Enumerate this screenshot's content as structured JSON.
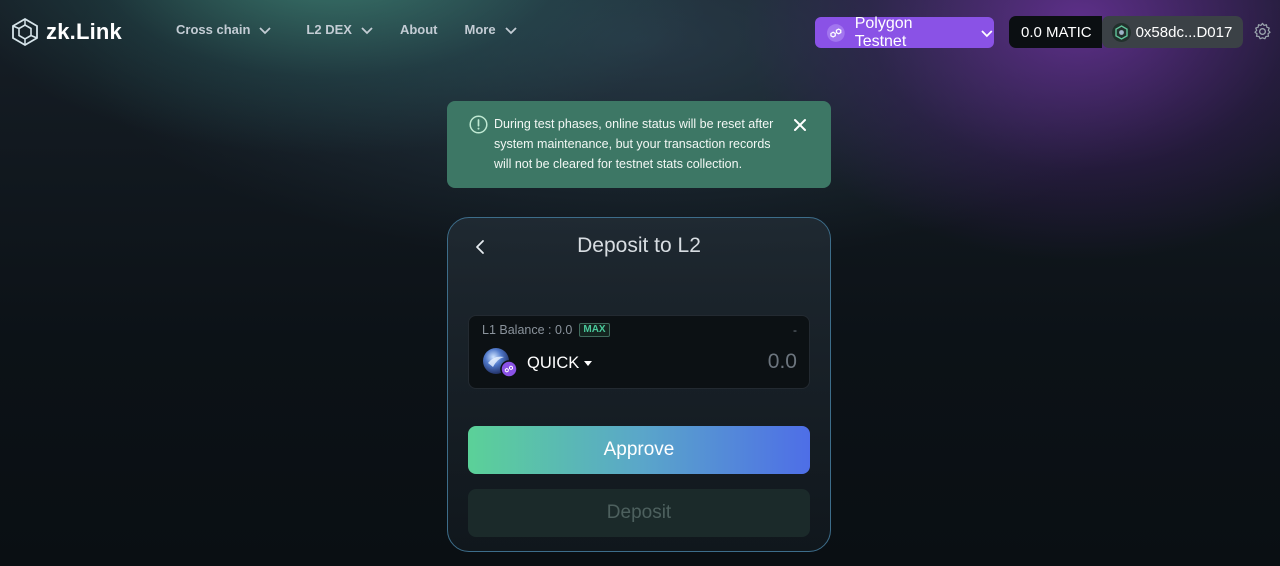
{
  "app": {
    "brand": "zk.Link"
  },
  "nav": {
    "items": [
      {
        "label": "Cross chain",
        "has_dropdown": true
      },
      {
        "label": "L2 DEX",
        "has_dropdown": true
      },
      {
        "label": "About",
        "has_dropdown": false
      },
      {
        "label": "More",
        "has_dropdown": true
      }
    ]
  },
  "network": {
    "label": "Polygon Testnet",
    "icon": "polygon-icon",
    "color": "#8a52e6"
  },
  "wallet": {
    "balance": "0.0 MATIC",
    "address": "0x58dc...D017"
  },
  "notice": {
    "text": "During test phases, online status will be reset after system maintenance, but your transaction records will not be cleared for testnet stats collection.",
    "color": "#3d7765"
  },
  "deposit": {
    "title": "Deposit to L2",
    "balance_label": "L1 Balance : 0.0",
    "max_label": "MAX",
    "usd_value": "-",
    "token": "QUICK",
    "amount_placeholder": "0.0",
    "approve_label": "Approve",
    "deposit_label": "Deposit"
  }
}
